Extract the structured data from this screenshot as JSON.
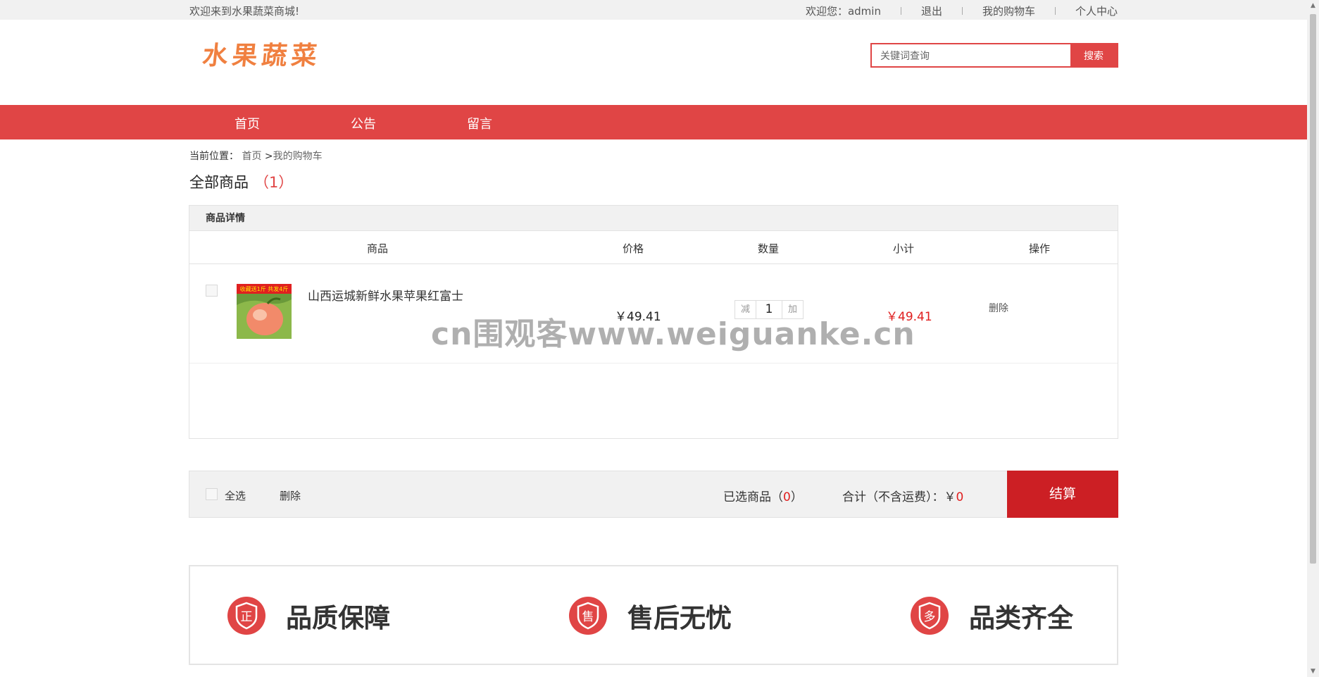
{
  "topbar": {
    "welcome": "欢迎来到水果蔬菜商城!",
    "user_greeting": "欢迎您：admin",
    "logout": "退出",
    "my_cart": "我的购物车",
    "personal_center": "个人中心"
  },
  "logo": {
    "text": "水果蔬菜"
  },
  "search": {
    "placeholder": "关键词查询",
    "button": "搜索"
  },
  "nav": {
    "items": [
      "首页",
      "公告",
      "留言"
    ]
  },
  "breadcrumb": {
    "label": "当前位置：",
    "home": "首页",
    "sep": ">",
    "current": "我的购物车"
  },
  "all_goods": {
    "title": "全部商品",
    "count": "（1）"
  },
  "cart": {
    "header": "商品详情",
    "columns": {
      "product": "商品",
      "price": "价格",
      "quantity": "数量",
      "subtotal": "小计",
      "action": "操作"
    },
    "items": [
      {
        "name": "山西运城新鲜水果苹果红富士",
        "price": "￥49.41",
        "qty_minus": "减",
        "quantity": "1",
        "qty_plus": "加",
        "subtotal": "￥49.41",
        "delete": "删除",
        "thumb_banner_text": "收藏送1斤 共发4斤"
      }
    ]
  },
  "footer_bar": {
    "select_all": "全选",
    "delete": "删除",
    "selected_label": "已选商品（",
    "selected_count": "0",
    "selected_close": "）",
    "total_label": "合计（不含运费）：￥",
    "total_value": "0",
    "checkout": "结算"
  },
  "features": [
    {
      "icon": "正",
      "label": "品质保障"
    },
    {
      "icon": "售",
      "label": "售后无忧"
    },
    {
      "icon": "多",
      "label": "品类齐全"
    }
  ],
  "watermark": "cn围观客www.weiguanke.cn",
  "colors": {
    "accent": "#e04545",
    "checkout": "#cc1f24",
    "price_red": "#e02020",
    "logo": "#f08040"
  }
}
